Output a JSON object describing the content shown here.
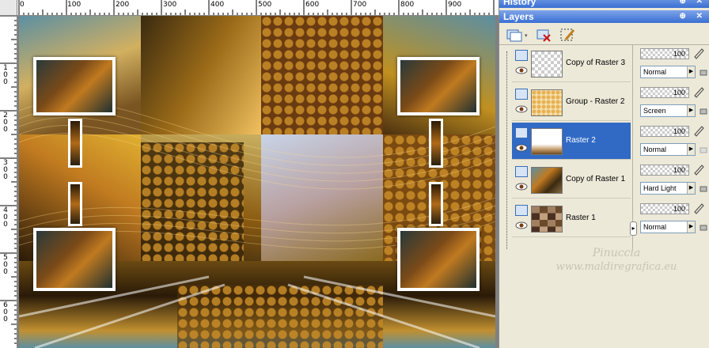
{
  "ruler": {
    "top_labels": [
      "0",
      "100",
      "200",
      "300",
      "400",
      "500",
      "600",
      "700",
      "800",
      "900"
    ],
    "left_labels": [
      "1\n0\n0",
      "2\n0\n0",
      "3\n0\n0",
      "4\n0\n0",
      "5\n0\n0",
      "6\n0\n0"
    ]
  },
  "history_panel": {
    "title": "History",
    "buttons": "⊕ ✕"
  },
  "layers_panel": {
    "title": "Layers",
    "buttons": "⊕ ✕",
    "layers": [
      {
        "name": "Copy of Raster 3",
        "opacity": "100",
        "blend_mode": "Normal",
        "selected": false
      },
      {
        "name": "Group - Raster 2",
        "opacity": "100",
        "blend_mode": "Screen",
        "selected": false
      },
      {
        "name": "Raster 2",
        "opacity": "100",
        "blend_mode": "Normal",
        "selected": true
      },
      {
        "name": "Copy of Raster 1",
        "opacity": "100",
        "blend_mode": "Hard Light",
        "selected": false
      },
      {
        "name": "Raster 1",
        "opacity": "100",
        "blend_mode": "Normal",
        "selected": false
      }
    ]
  },
  "watermark": {
    "line1": "Pinuccia",
    "line2": "www.maldiregrafica.eu"
  },
  "colors": {
    "selection": "#316ac5",
    "header_start": "#7fa4e8",
    "header_end": "#3a6fd3",
    "panel_bg": "#ece9d8"
  }
}
